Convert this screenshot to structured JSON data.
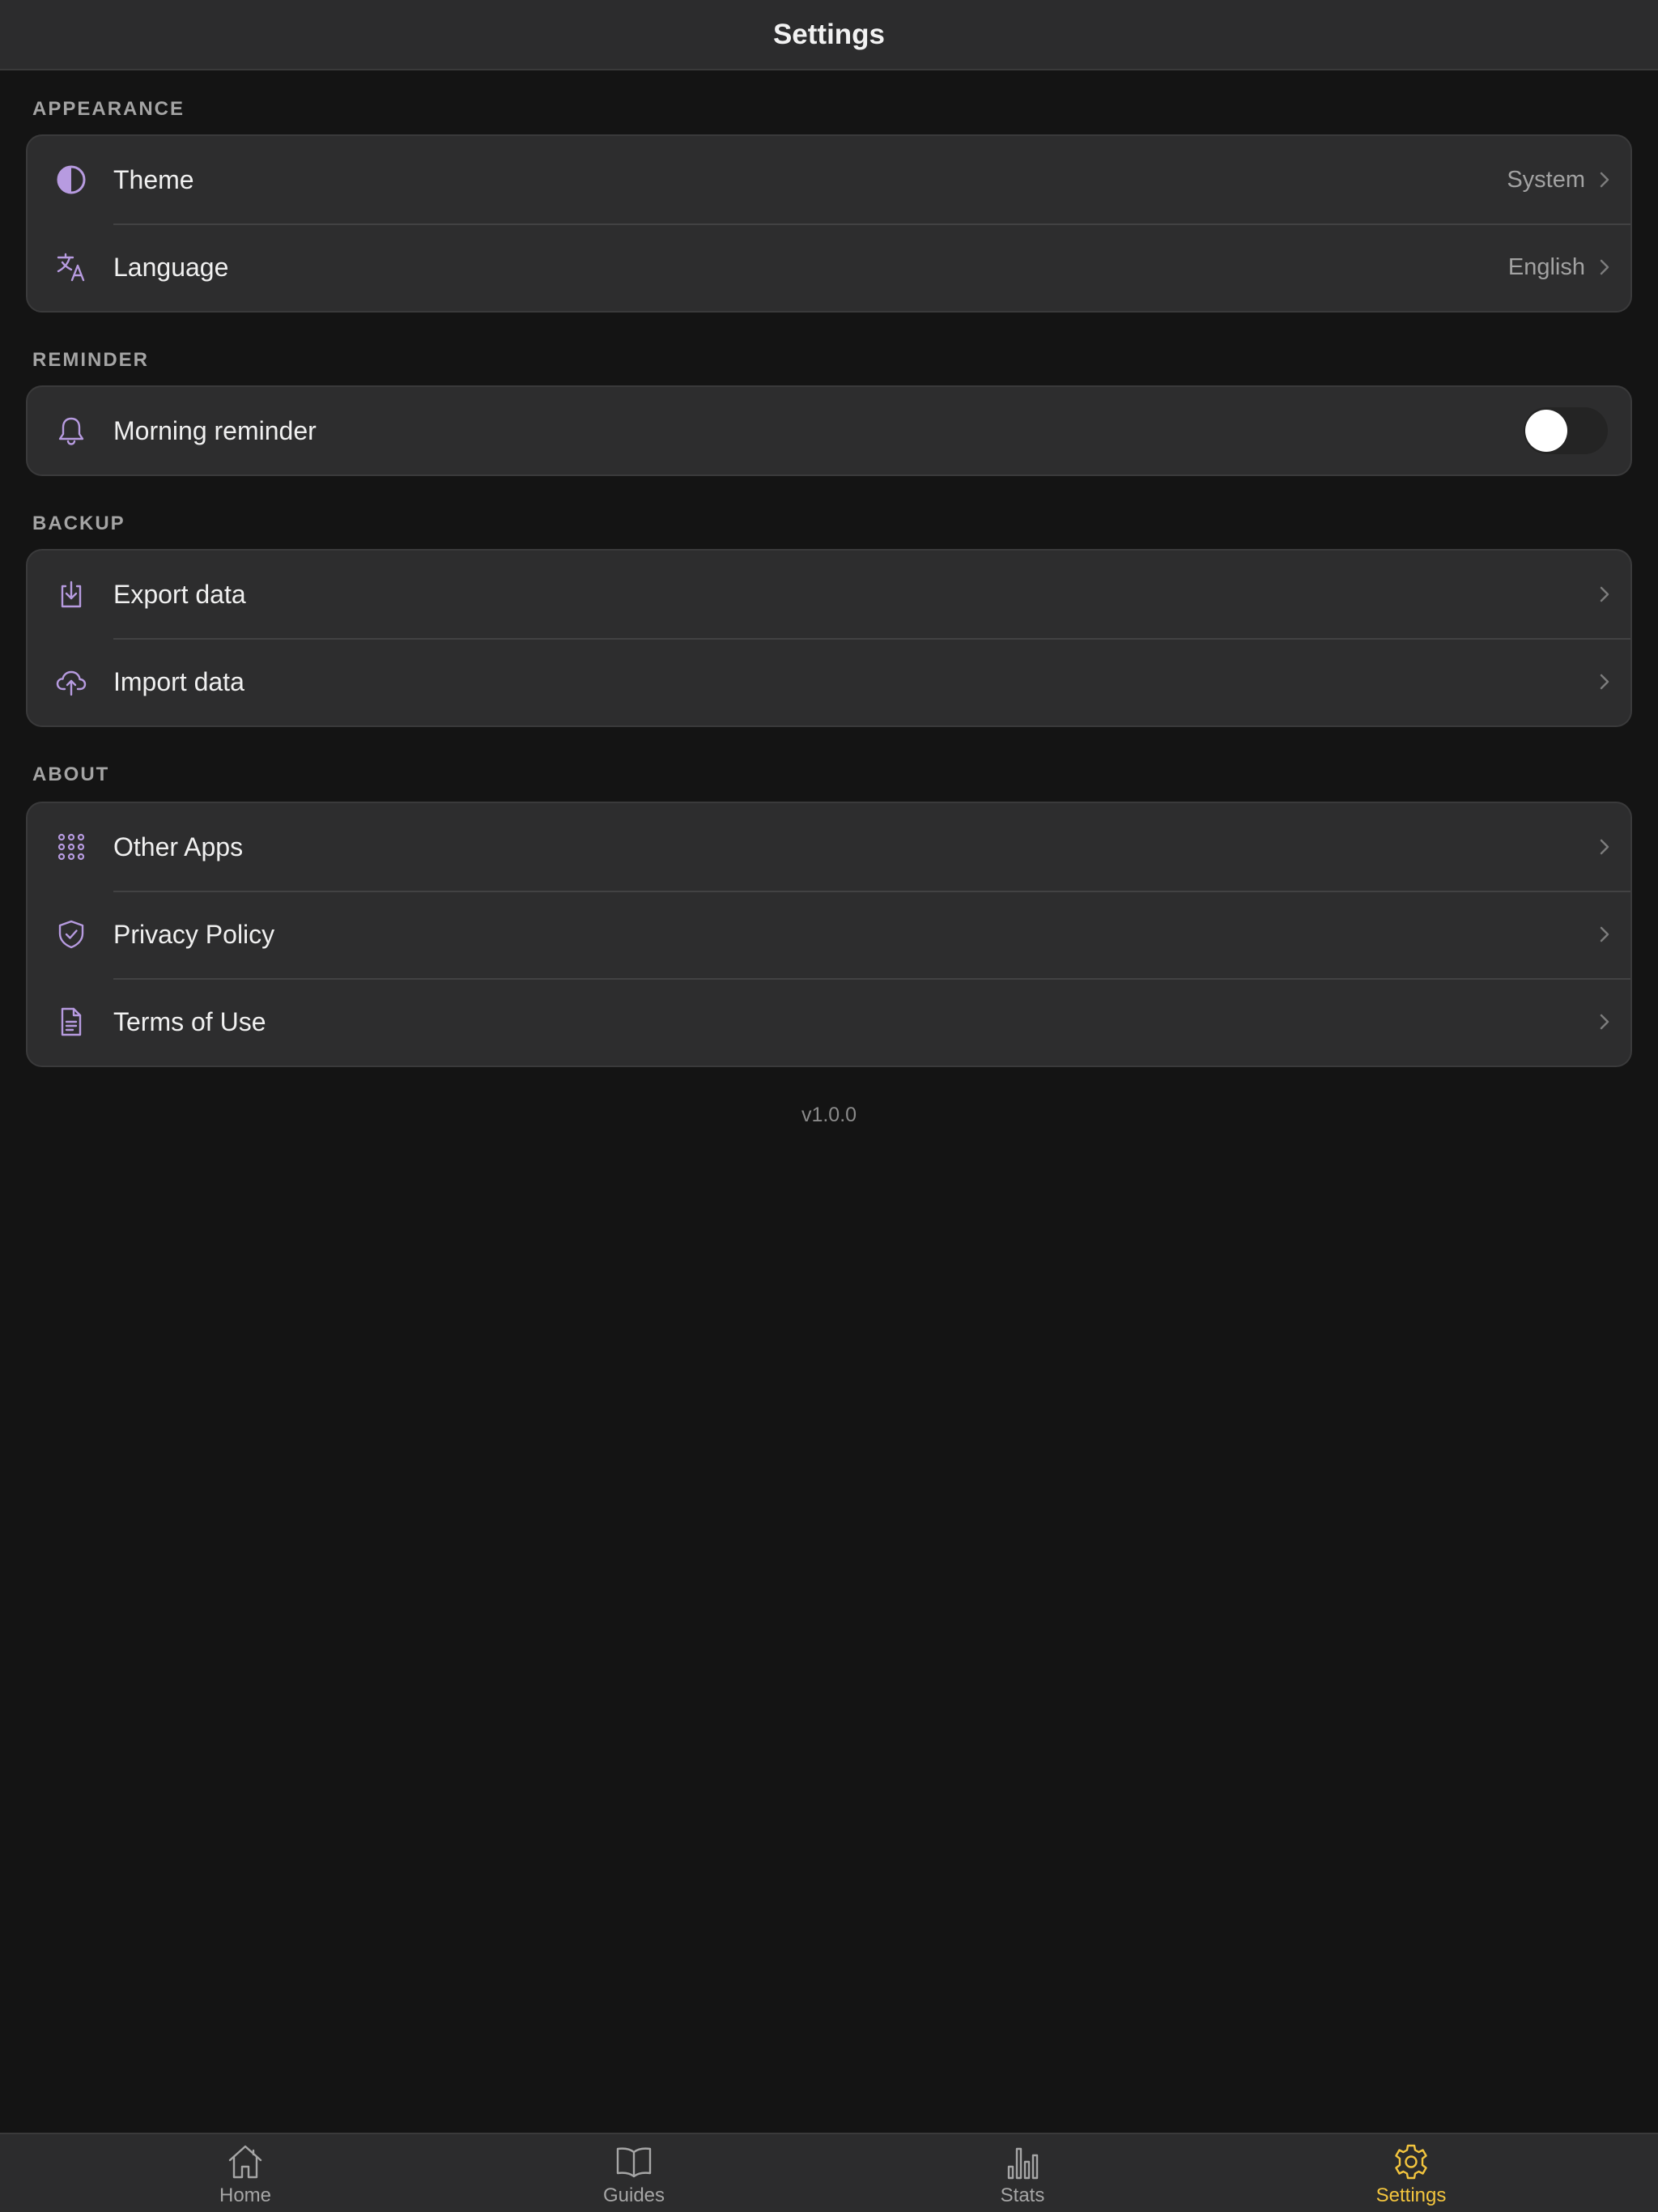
{
  "header": {
    "title": "Settings"
  },
  "sections": {
    "appearance": {
      "label": "APPEARANCE",
      "theme": {
        "label": "Theme",
        "value": "System",
        "icon": "half-circle-icon"
      },
      "language": {
        "label": "Language",
        "value": "English",
        "icon": "translate-icon"
      }
    },
    "reminder": {
      "label": "REMINDER",
      "morning": {
        "label": "Morning reminder",
        "icon": "bell-icon",
        "enabled": false
      }
    },
    "backup": {
      "label": "BACKUP",
      "export": {
        "label": "Export data",
        "icon": "download-icon"
      },
      "import": {
        "label": "Import data",
        "icon": "cloud-upload-icon"
      }
    },
    "about": {
      "label": "ABOUT",
      "other_apps": {
        "label": "Other Apps",
        "icon": "grid-dots-icon"
      },
      "privacy": {
        "label": "Privacy Policy",
        "icon": "shield-check-icon"
      },
      "terms": {
        "label": "Terms of Use",
        "icon": "document-icon"
      }
    }
  },
  "version": "v1.0.0",
  "tabbar": {
    "home": "Home",
    "guides": "Guides",
    "stats": "Stats",
    "settings": "Settings",
    "active": "settings"
  },
  "colors": {
    "background": "#141414",
    "card": "#2d2d2e",
    "accent_icon": "#b79be0",
    "active_tab": "#f3c53e"
  }
}
